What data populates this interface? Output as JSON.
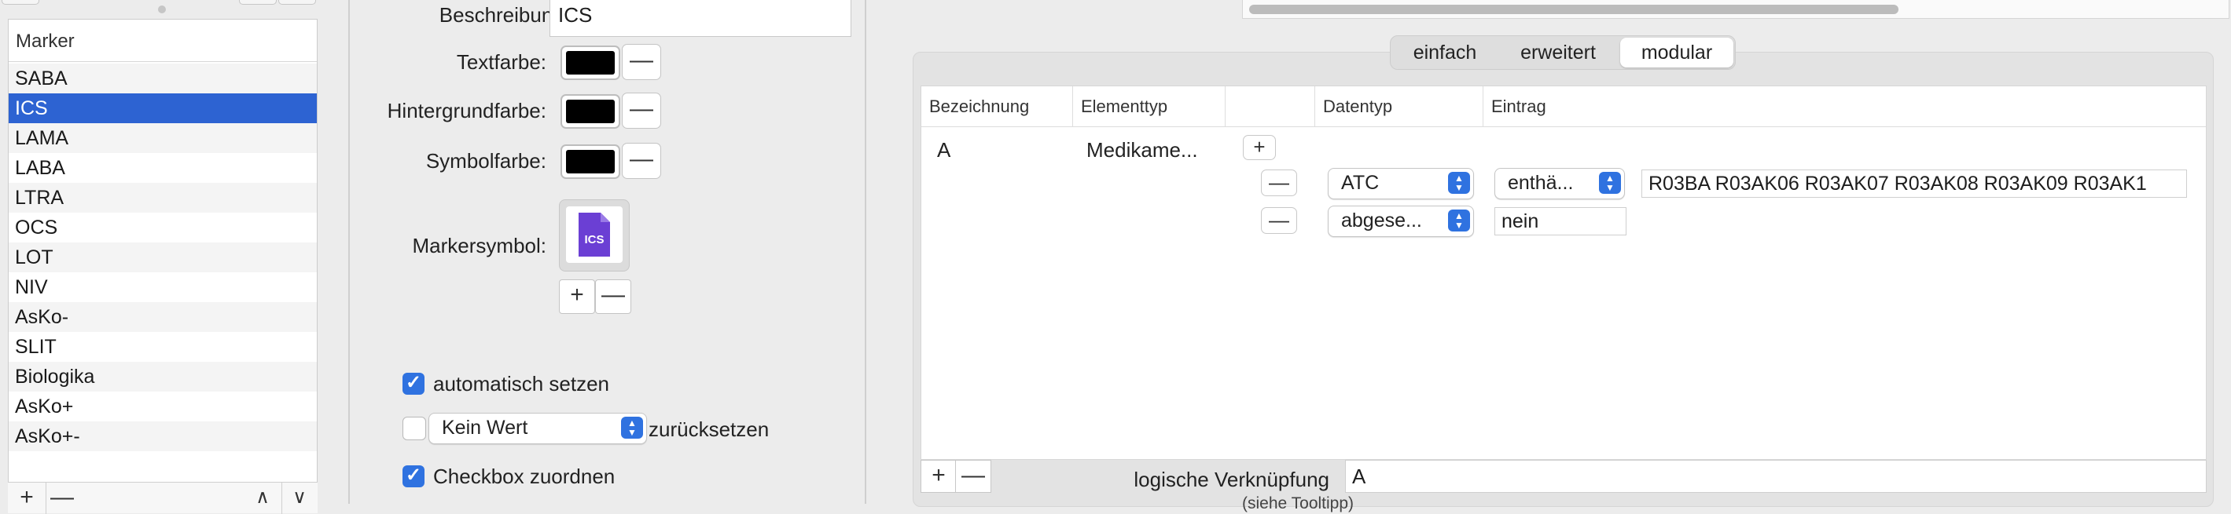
{
  "marker_list": {
    "header": "Marker",
    "items": [
      "SABA",
      "ICS",
      "LAMA",
      "LABA",
      "LTRA",
      "OCS",
      "LOT",
      "NIV",
      "AsKo-",
      "SLIT",
      "Biologika",
      "AsKo+",
      "AsKo+-"
    ],
    "selected_index": 1,
    "toolbar": {
      "add": "+",
      "remove": "—",
      "up": "∧",
      "down": "∨"
    }
  },
  "form": {
    "beschreibung_label": "Beschreibung:",
    "beschreibung_value": "ICS",
    "textfarbe_label": "Textfarbe:",
    "hintergrundfarbe_label": "Hintergrundfarbe:",
    "symbolfarbe_label": "Symbolfarbe:",
    "minus": "—",
    "plus": "+",
    "markersymbol_label": "Markersymbol:",
    "markersymbol_icon_text": "ICS",
    "auto_label": "automatisch setzen",
    "reset_select": "Kein Wert",
    "reset_label": "zurücksetzen",
    "checkbox_label": "Checkbox zuordnen",
    "colors": {
      "text": "#000000",
      "background": "#000000",
      "symbol": "#000000",
      "icon": "#6b3fd4"
    }
  },
  "right": {
    "tabs": [
      "einfach",
      "erweitert",
      "modular"
    ],
    "active_tab": "modular",
    "columns": [
      "Bezeichnung",
      "Elementtyp",
      "",
      "Datentyp",
      "Eintrag"
    ],
    "row": {
      "bezeichnung": "A",
      "elementtyp": "Medikame...",
      "add": "+",
      "conditions": [
        {
          "remove": "—",
          "datentyp": "ATC",
          "operator": "enthä...",
          "wert": "R03BA R03AK06 R03AK07 R03AK08 R03AK09 R03AK1"
        },
        {
          "remove": "—",
          "datentyp": "abgese...",
          "eintrag": "nein"
        }
      ]
    },
    "bottom": {
      "add": "+",
      "remove": "—",
      "logic_label": "logische Verknüpfung",
      "logic_hint": "(siehe Tooltipp)",
      "logic_value": "A"
    }
  }
}
